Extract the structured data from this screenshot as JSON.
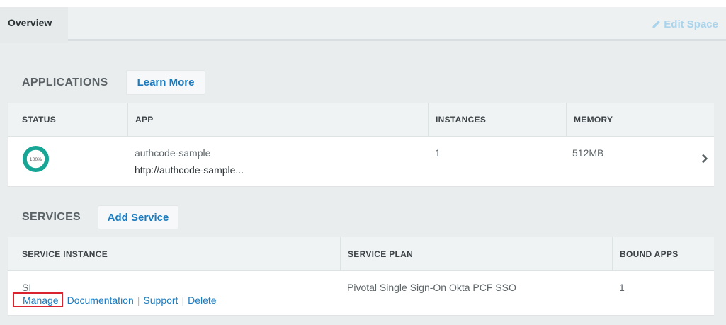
{
  "tabs": {
    "overview": "Overview",
    "edit_space": "Edit Space"
  },
  "applications": {
    "title": "APPLICATIONS",
    "learn_more": "Learn More",
    "columns": [
      "STATUS",
      "APP",
      "INSTANCES",
      "MEMORY"
    ],
    "rows": [
      {
        "status_pct": "100%",
        "name": "authcode-sample",
        "url": "http://authcode-sample...",
        "instances": "1",
        "memory": "512MB"
      }
    ]
  },
  "services": {
    "title": "SERVICES",
    "add_service": "Add Service",
    "columns": [
      "SERVICE INSTANCE",
      "SERVICE PLAN",
      "BOUND APPS"
    ],
    "rows": [
      {
        "instance": "SI",
        "plan": "Pivotal Single Sign-On Okta PCF SSO",
        "bound_apps": "1",
        "actions": [
          "Manage",
          "Documentation",
          "Support",
          "Delete"
        ]
      }
    ]
  },
  "colors": {
    "accent": "#1a7bbf",
    "status_ring": "#17a596",
    "highlight": "#d9232e"
  },
  "icons": {
    "edit": "pencil-icon",
    "row_open": "chevron-right-icon",
    "status": "status-donut-icon"
  }
}
